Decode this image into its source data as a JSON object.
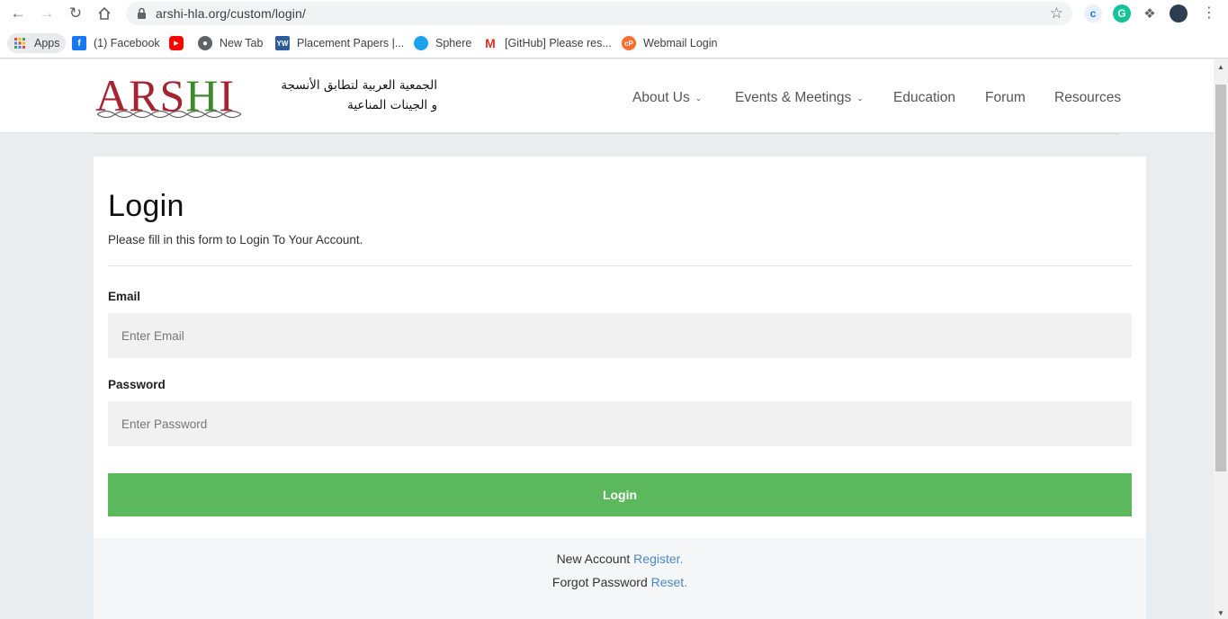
{
  "browser": {
    "url": "arshi-hla.org/custom/login/",
    "bookmarks": [
      {
        "label": "Apps",
        "icon": "apps-grid-icon"
      },
      {
        "label": "(1) Facebook",
        "icon": "facebook-icon"
      },
      {
        "label": "",
        "icon": "youtube-icon"
      },
      {
        "label": "New Tab",
        "icon": "globe-icon"
      },
      {
        "label": "Placement Papers |...",
        "icon": "yw-icon"
      },
      {
        "label": "Sphere",
        "icon": "sphere-icon"
      },
      {
        "label": "[GitHub] Please res...",
        "icon": "gmail-icon"
      },
      {
        "label": "Webmail Login",
        "icon": "cpanel-icon"
      }
    ]
  },
  "site": {
    "logo_latin_1": "ARS",
    "logo_latin_2": "H",
    "logo_latin_3": "I",
    "logo_arabic_1": "الجمعية العربية لتطابق الأنسجة",
    "logo_arabic_2": "و الجينات المناعية",
    "nav": [
      {
        "label": "About Us",
        "has_dropdown": true
      },
      {
        "label": "Events & Meetings",
        "has_dropdown": true
      },
      {
        "label": "Education",
        "has_dropdown": false
      },
      {
        "label": "Forum",
        "has_dropdown": false
      },
      {
        "label": "Resources",
        "has_dropdown": false
      }
    ]
  },
  "form": {
    "title": "Login",
    "subtitle": "Please fill in this form to Login To Your Account.",
    "email_label": "Email",
    "email_placeholder": "Enter Email",
    "password_label": "Password",
    "password_placeholder": "Enter Password",
    "submit_label": "Login"
  },
  "footer": {
    "new_account_text": "New Account",
    "register_link": "Register.",
    "forgot_text": "Forgot Password",
    "reset_link": "Reset."
  },
  "colors": {
    "brand_red": "#a52432",
    "brand_green": "#3c8a2c",
    "button_green": "#5cb85c",
    "link_blue": "#4a88c7"
  }
}
